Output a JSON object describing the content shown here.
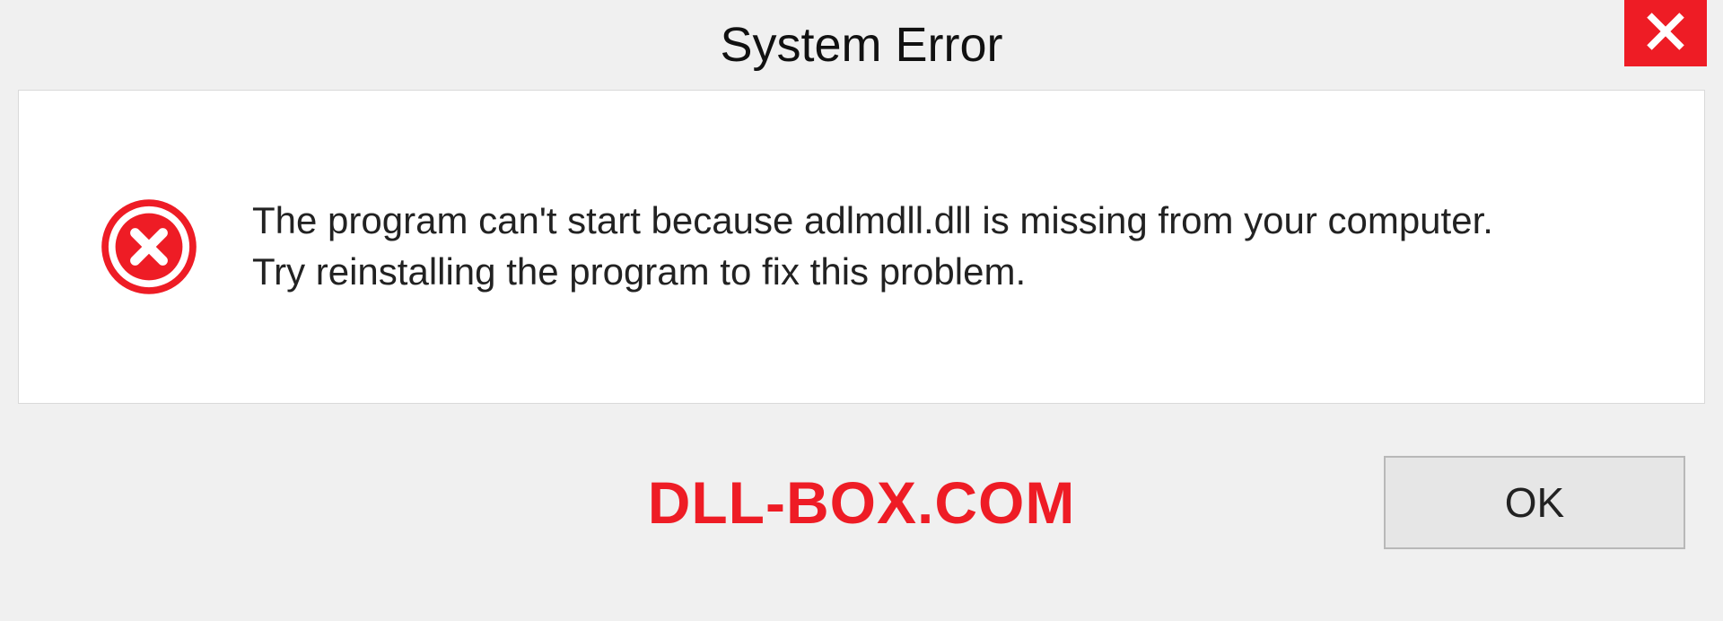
{
  "dialog": {
    "title": "System Error",
    "message_line1": "The program can't start because adlmdll.dll is missing from your computer.",
    "message_line2": "Try reinstalling the program to fix this problem.",
    "ok_label": "OK"
  },
  "watermark": "DLL-BOX.COM",
  "colors": {
    "error_red": "#ee1c25"
  }
}
